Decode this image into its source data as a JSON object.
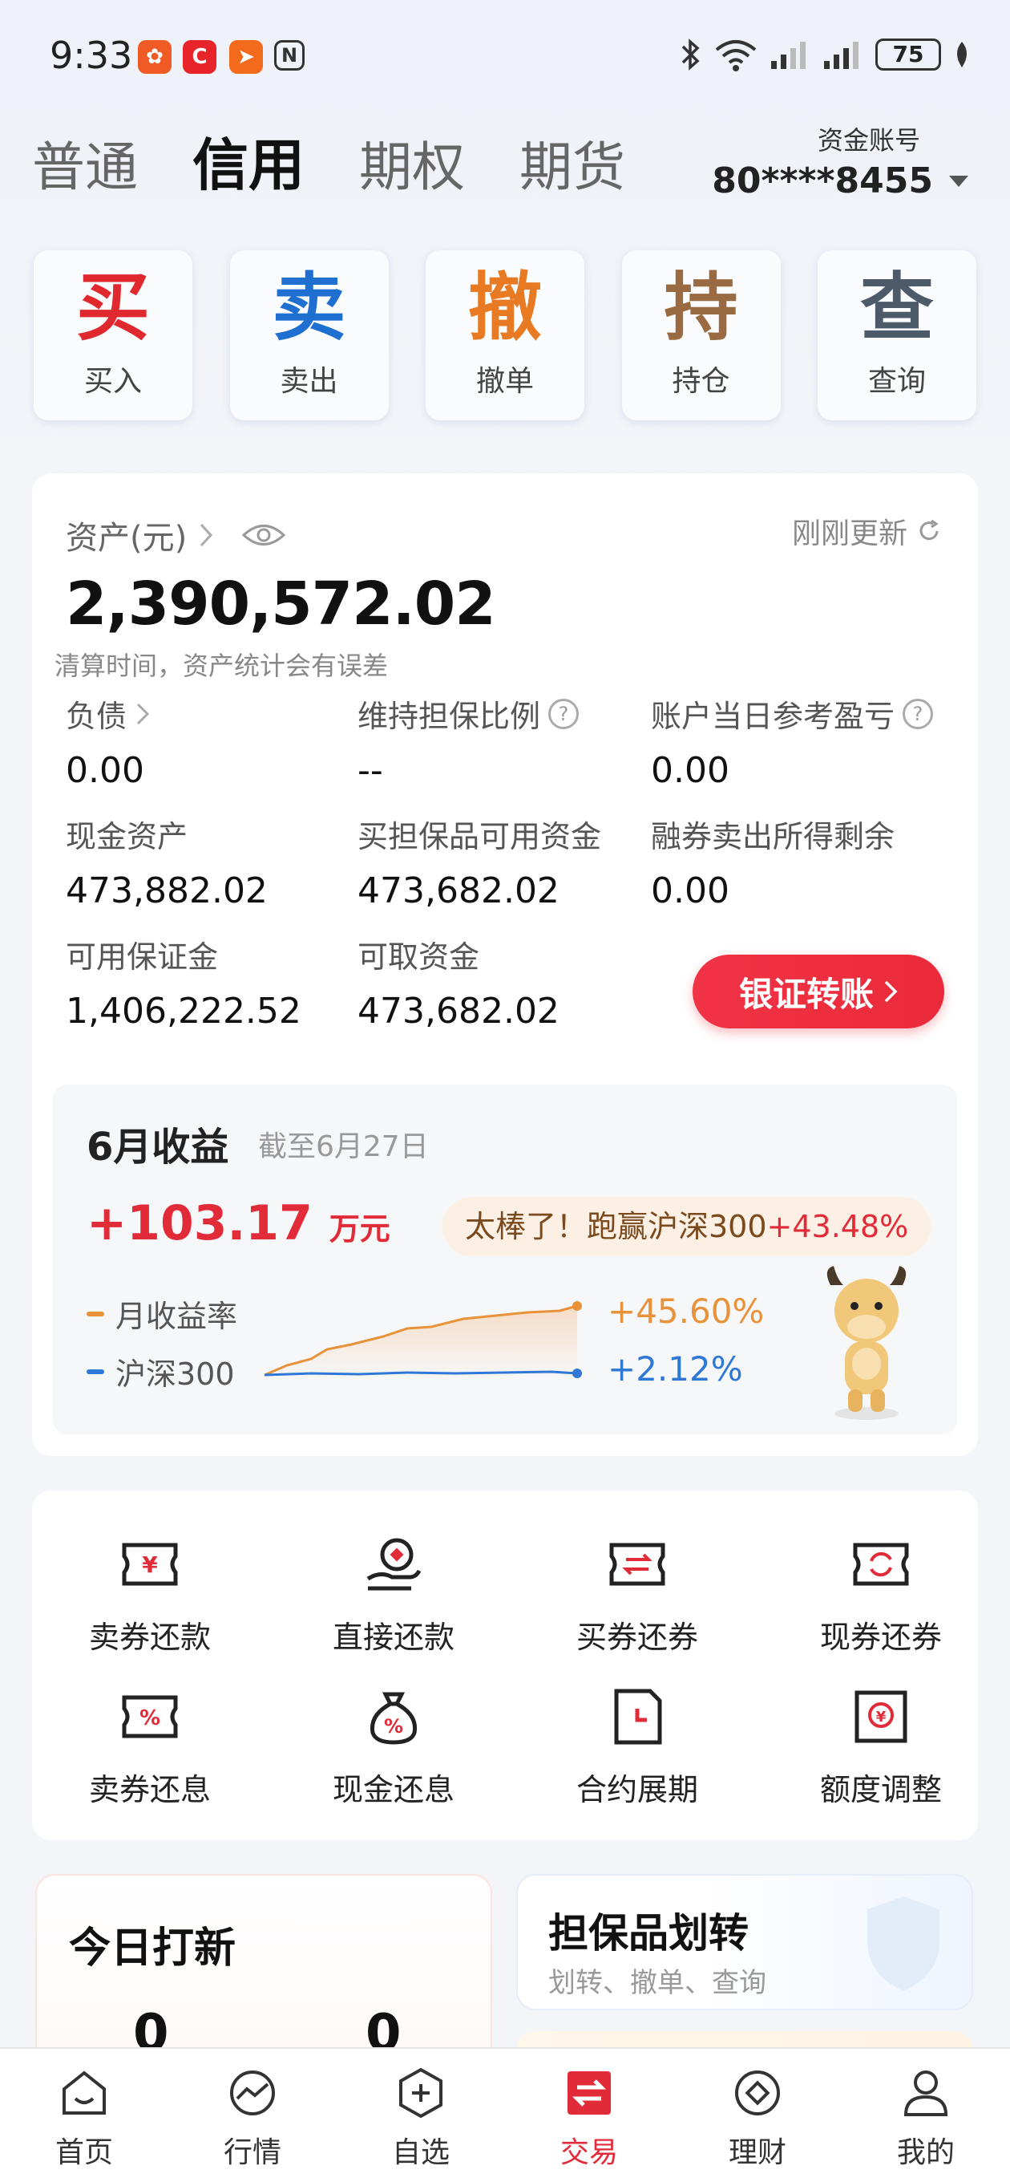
{
  "status_bar": {
    "time": "9:33",
    "battery": "75"
  },
  "tabs": [
    {
      "label": "普通",
      "active": false
    },
    {
      "label": "信用",
      "active": true
    },
    {
      "label": "期权",
      "active": false
    },
    {
      "label": "期货",
      "active": false
    }
  ],
  "account": {
    "label": "资金账号",
    "number": "80****8455"
  },
  "quick_actions": [
    {
      "big": "买",
      "small": "买入",
      "color": "#e0292f"
    },
    {
      "big": "卖",
      "small": "卖出",
      "color": "#1f6fd1"
    },
    {
      "big": "撤",
      "small": "撤单",
      "color": "#e87a23"
    },
    {
      "big": "持",
      "small": "持仓",
      "color": "#9a6b42"
    },
    {
      "big": "查",
      "small": "查询",
      "color": "#4d5a6a"
    }
  ],
  "assets": {
    "title": "资产(元)",
    "refresh": "刚刚更新",
    "total": "2,390,572.02",
    "note": "清算时间，资产统计会有误差",
    "items": [
      {
        "label": "负债",
        "value": "0.00"
      },
      {
        "label": "维持担保比例",
        "value": "--"
      },
      {
        "label": "账户当日参考盈亏",
        "value": "0.00"
      },
      {
        "label": "现金资产",
        "value": "473,882.02"
      },
      {
        "label": "买担保品可用资金",
        "value": "473,682.02"
      },
      {
        "label": "融券卖出所得剩余",
        "value": "0.00"
      },
      {
        "label": "可用保证金",
        "value": "1,406,222.52"
      },
      {
        "label": "可取资金",
        "value": "473,682.02"
      }
    ],
    "transfer_button": "银证转账"
  },
  "income": {
    "title": "6月收益",
    "date": "截至6月27日",
    "amount": "+103.17",
    "unit": "万元",
    "bubble_text": "太棒了！跑赢沪深300",
    "bubble_pct": "+43.48%",
    "series": [
      {
        "name": "月收益率",
        "value": "+45.60%",
        "color": "#e8923a"
      },
      {
        "name": "沪深300",
        "value": "+2.12%",
        "color": "#2f78d6"
      }
    ]
  },
  "tools": [
    {
      "label": "卖券还款",
      "icon": "ticket-yen-icon"
    },
    {
      "label": "直接还款",
      "icon": "hand-coin-icon"
    },
    {
      "label": "买券还券",
      "icon": "ticket-exchange-icon"
    },
    {
      "label": "现券还券",
      "icon": "ticket-refresh-icon"
    },
    {
      "label": "卖券还息",
      "icon": "ticket-percent-icon"
    },
    {
      "label": "现金还息",
      "icon": "money-bag-icon"
    },
    {
      "label": "合约展期",
      "icon": "document-clock-icon"
    },
    {
      "label": "额度调整",
      "icon": "document-yen-icon"
    }
  ],
  "ipo": {
    "title": "今日打新",
    "count1": "0",
    "count2": "0"
  },
  "collateral": {
    "title": "担保品划转",
    "subtitle": "划转、撤单、查询"
  },
  "bottom_nav": [
    {
      "label": "首页",
      "icon": "home-icon",
      "active": false
    },
    {
      "label": "行情",
      "icon": "market-icon",
      "active": false
    },
    {
      "label": "自选",
      "icon": "watchlist-add-icon",
      "active": false
    },
    {
      "label": "交易",
      "icon": "trade-icon",
      "active": true
    },
    {
      "label": "理财",
      "icon": "wealth-icon",
      "active": false
    },
    {
      "label": "我的",
      "icon": "profile-icon",
      "active": false
    }
  ]
}
